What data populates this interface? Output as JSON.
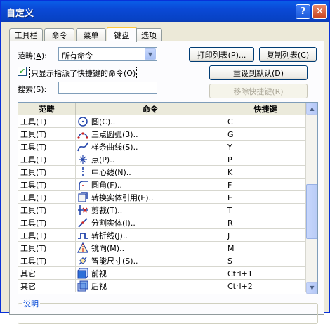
{
  "window": {
    "title": "自定义"
  },
  "titlebar": {
    "help_label": "?",
    "close_label": "✕"
  },
  "tabs": [
    {
      "label": "工具栏",
      "active": false
    },
    {
      "label": "命令",
      "active": false
    },
    {
      "label": "菜单",
      "active": false
    },
    {
      "label": "键盘",
      "active": true
    },
    {
      "label": "选项",
      "active": false
    }
  ],
  "category": {
    "label": "范畴(",
    "accel": "A",
    "label_end": "):",
    "value": "所有命令"
  },
  "buttons": {
    "print_list": "打印列表(P)...",
    "copy_list": "复制列表(C)",
    "reset_default": "重设到默认(D)",
    "remove_shortcut": "移除快捷键(R)"
  },
  "filter": {
    "checked": true,
    "check_glyph": "✔",
    "label": "只显示指派了快捷键的命令(O)"
  },
  "search": {
    "label": "搜索(",
    "accel": "S",
    "label_end": "):",
    "value": ""
  },
  "table": {
    "headers": [
      "范畴",
      "命令",
      "快捷键"
    ],
    "rows": [
      {
        "category": "工具(T)",
        "icon": "circle-icon",
        "command": "圆(C)..",
        "shortcut": "C"
      },
      {
        "category": "工具(T)",
        "icon": "three-point-arc-icon",
        "command": "三点圆弧(3)..",
        "shortcut": "G"
      },
      {
        "category": "工具(T)",
        "icon": "spline-icon",
        "command": "样条曲线(S)..",
        "shortcut": "Y"
      },
      {
        "category": "工具(T)",
        "icon": "point-icon",
        "command": "点(P)..",
        "shortcut": "P"
      },
      {
        "category": "工具(T)",
        "icon": "centerline-icon",
        "command": "中心线(N)..",
        "shortcut": "K"
      },
      {
        "category": "工具(T)",
        "icon": "fillet-icon",
        "command": "圆角(F)..",
        "shortcut": "F"
      },
      {
        "category": "工具(T)",
        "icon": "convert-entities-icon",
        "command": "转换实体引用(E)..",
        "shortcut": "E"
      },
      {
        "category": "工具(T)",
        "icon": "trim-icon",
        "command": "剪裁(T)..",
        "shortcut": "T"
      },
      {
        "category": "工具(T)",
        "icon": "split-entities-icon",
        "command": "分割实体(I)..",
        "shortcut": "R"
      },
      {
        "category": "工具(T)",
        "icon": "jog-line-icon",
        "command": "转折线(J)..",
        "shortcut": "J"
      },
      {
        "category": "工具(T)",
        "icon": "mirror-icon",
        "command": "镜向(M)..",
        "shortcut": "M"
      },
      {
        "category": "工具(T)",
        "icon": "smart-dimension-icon",
        "command": "智能尺寸(S)..",
        "shortcut": "S"
      },
      {
        "category": "其它",
        "icon": "front-view-icon",
        "command": "前视",
        "shortcut": "Ctrl+1"
      },
      {
        "category": "其它",
        "icon": "back-view-icon",
        "command": "后视",
        "shortcut": "Ctrl+2"
      }
    ]
  },
  "scrollbar": {
    "position": 0.62
  },
  "description": {
    "label": "说明"
  }
}
